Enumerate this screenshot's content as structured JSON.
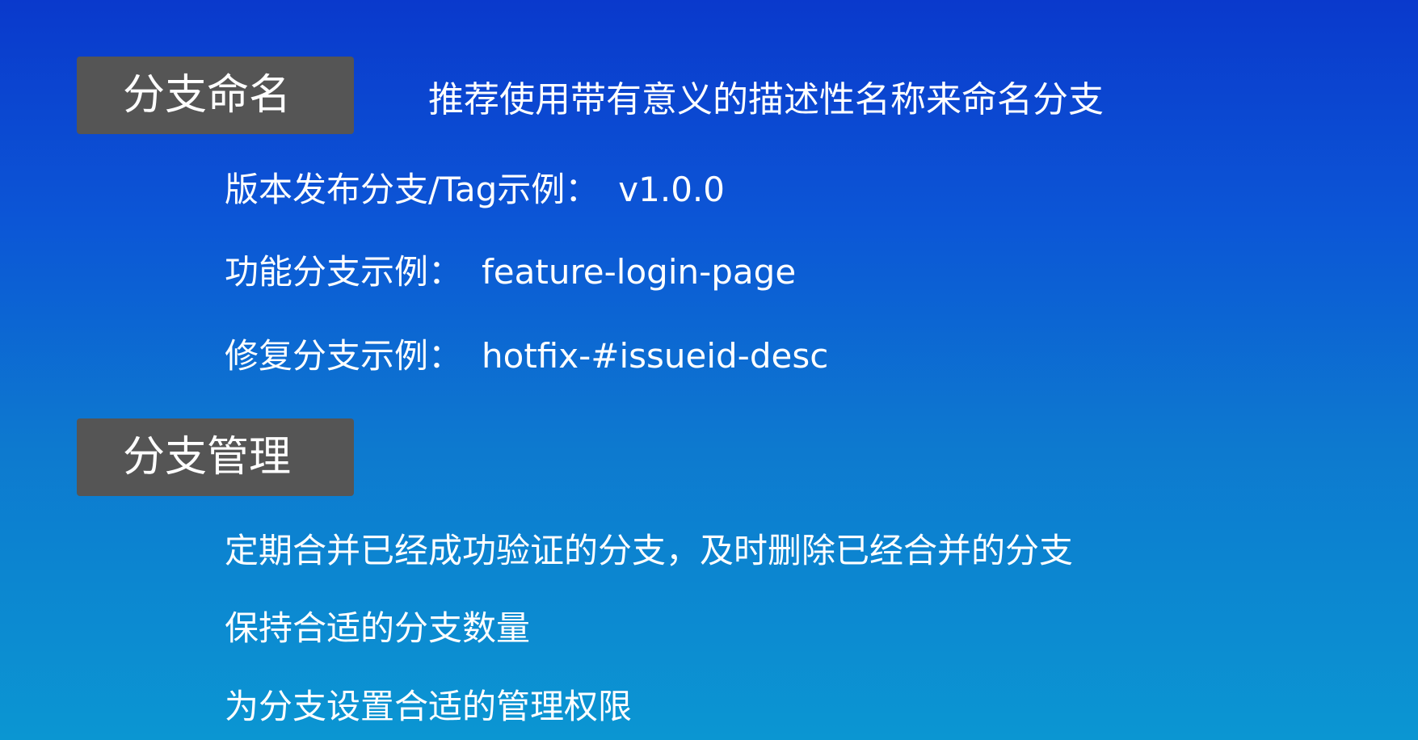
{
  "naming": {
    "title": "分支命名",
    "description": "推荐使用带有意义的描述性名称来命名分支",
    "examples": [
      {
        "label": "版本发布分支/Tag示例：",
        "value": "v1.0.0"
      },
      {
        "label": "功能分支示例：",
        "value": "feature-login-page"
      },
      {
        "label": "修复分支示例：",
        "value": "hotfix-#issueid-desc"
      }
    ]
  },
  "management": {
    "title": "分支管理",
    "items": [
      "定期合并已经成功验证的分支，及时删除已经合并的分支",
      "保持合适的分支数量",
      "为分支设置合适的管理权限"
    ]
  }
}
